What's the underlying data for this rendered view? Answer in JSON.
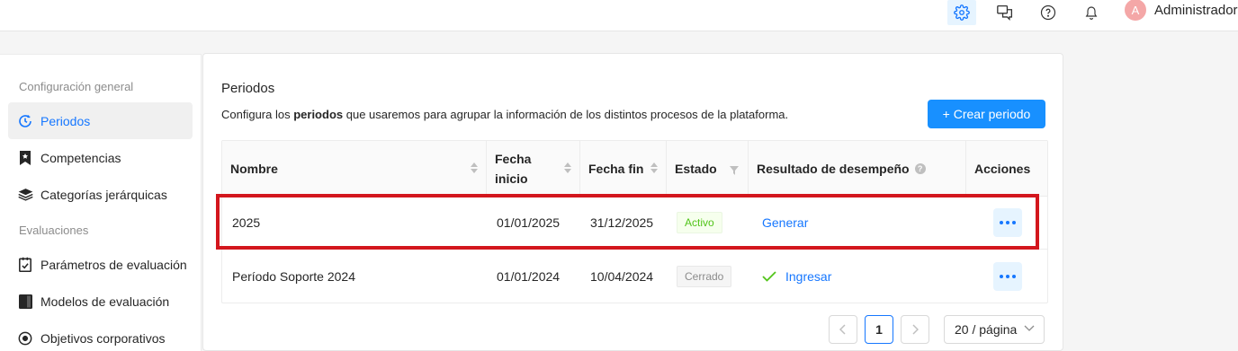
{
  "topbar": {
    "icons": [
      "gear-icon",
      "chat-icon",
      "help-icon",
      "bell-icon"
    ],
    "avatar_initial": "A",
    "user_name": "Administrador"
  },
  "sidebar": {
    "section_general": "Configuración general",
    "items_general": [
      {
        "label": "Periodos",
        "icon": "period-icon",
        "active": true
      },
      {
        "label": "Competencias",
        "icon": "bookmark-icon",
        "active": false
      },
      {
        "label": "Categorías jerárquicas",
        "icon": "layers-icon",
        "active": false
      }
    ],
    "section_eval": "Evaluaciones",
    "items_eval": [
      {
        "label": "Parámetros de evaluación",
        "icon": "checklist-icon",
        "active": false
      },
      {
        "label": "Modelos de evaluación",
        "icon": "book-icon",
        "active": false
      },
      {
        "label": "Objetivos corporativos",
        "icon": "target-icon",
        "active": false
      }
    ]
  },
  "main": {
    "title": "Periodos",
    "desc_pre": "Configura los ",
    "desc_bold": "periodos",
    "desc_post": " que usaremos para agrupar la información de los distintos procesos de la plataforma.",
    "create_button": "+ Crear periodo"
  },
  "table": {
    "headers": {
      "name": "Nombre",
      "start_line1": "Fecha",
      "start_line2": "inicio",
      "end": "Fecha fin",
      "status": "Estado",
      "result": "Resultado de desempeño",
      "actions": "Acciones"
    },
    "rows": [
      {
        "name": "2025",
        "start": "01/01/2025",
        "end": "31/12/2025",
        "status": "Activo",
        "result": "Generar"
      },
      {
        "name": "Período Soporte 2024",
        "start": "01/01/2024",
        "end": "10/04/2024",
        "status": "Cerrado",
        "result": "Ingresar"
      }
    ]
  },
  "pagination": {
    "current": "1",
    "page_size": "20 / página"
  },
  "colors": {
    "primary": "#1890ff",
    "highlight": "#d3161d",
    "active_green": "#52c41a"
  }
}
